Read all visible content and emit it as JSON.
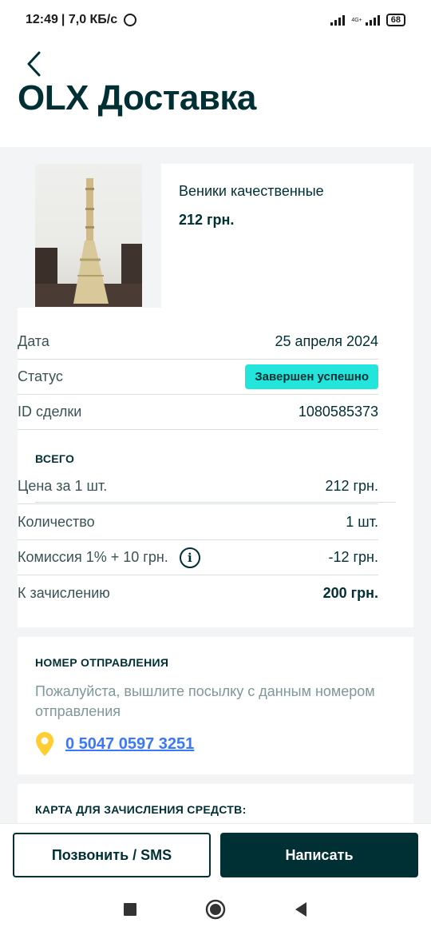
{
  "status_bar": {
    "time": "12:49",
    "speed": "| 7,0 КБ/с",
    "network": "4G+",
    "battery": "68"
  },
  "header": {
    "title": "OLX Доставка"
  },
  "product": {
    "name": "Веники качественные",
    "price": "212 грн."
  },
  "details": {
    "date_label": "Дата",
    "date_value": "25 апреля 2024",
    "status_label": "Статус",
    "status_value": "Завершен успешно",
    "deal_id_label": "ID сделки",
    "deal_id_value": "1080585373"
  },
  "totals": {
    "section_title": "ВСЕГО",
    "unit_price_label": "Цена за 1 шт.",
    "unit_price_value": "212 грн.",
    "quantity_label": "Количество",
    "quantity_value": "1 шт.",
    "commission_label": "Комиссия 1% + 10 грн.",
    "commission_value": "-12 грн.",
    "payout_label": "К зачислению",
    "payout_value": "200 грн."
  },
  "tracking": {
    "section_title": "НОМЕР ОТПРАВЛЕНИЯ",
    "hint": "Пожалуйста, вышлите посылку с данным номером отправления",
    "number": "0 5047 0597 3251"
  },
  "card": {
    "section_title": "КАРТА ДЛЯ ЗАЧИСЛЕНИЯ СРЕДСТВ:"
  },
  "actions": {
    "call_label": "Позвонить / SMS",
    "message_label": "Написать"
  },
  "colors": {
    "primary": "#002f34",
    "badge": "#23e5db",
    "link": "#3a77ff",
    "pin": "#ffce32",
    "background": "#f2f4f5"
  }
}
